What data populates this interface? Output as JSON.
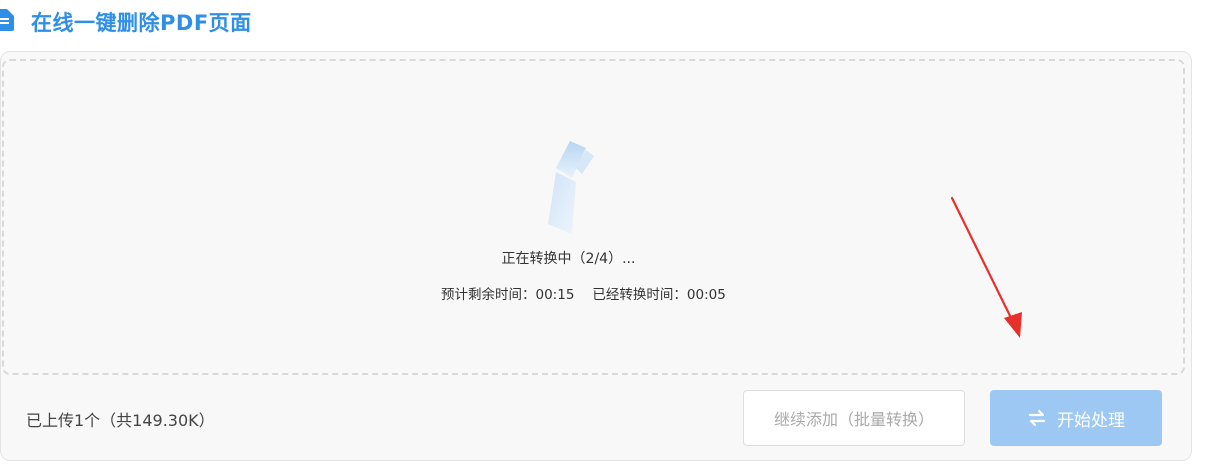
{
  "header": {
    "title": "在线一键删除PDF页面",
    "icon": "document-icon",
    "accent_color": "#2f8fe6"
  },
  "progress": {
    "status": "正在转换中（2/4）...",
    "current_file": 2,
    "total_files": 4,
    "remaining_label": "预计剩余时间：",
    "remaining_value": "00:15",
    "elapsed_label": "已经转换时间：",
    "elapsed_value": "00:05"
  },
  "footer": {
    "upload_info": "已上传1个（共149.30K）",
    "add_button_label": "继续添加（批量转换）",
    "start_button_label": "开始处理",
    "start_button_icon": "swap-arrows-icon",
    "start_button_color": "#9dc8f4"
  },
  "annotation": {
    "arrow_color": "#e8302a"
  }
}
